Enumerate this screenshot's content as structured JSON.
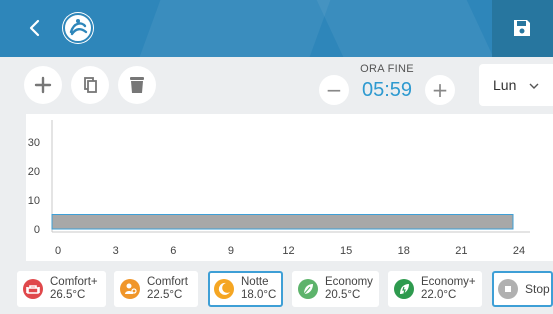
{
  "header": {
    "back_icon": "chevron-left-icon",
    "logo_icon": "climate-logo-icon",
    "save_icon": "floppy-disk-icon",
    "color": "#2e86ba"
  },
  "toolbar": {
    "add_icon": "plus-icon",
    "copy_icon": "copy-icon",
    "delete_icon": "trash-icon",
    "end_time_label": "ORA FINE",
    "decrement_label": "−",
    "increment_label": "+",
    "end_time_value": "05:59",
    "day_value": "Lun"
  },
  "chart_data": {
    "type": "bar",
    "x_ticks": [
      "0",
      "3",
      "6",
      "9",
      "12",
      "15",
      "18",
      "21",
      "24"
    ],
    "y_ticks": [
      "0",
      "10",
      "20",
      "30"
    ],
    "xlim": [
      0,
      24
    ],
    "ylim": [
      0,
      30
    ],
    "segments": [
      {
        "start": 0,
        "end": 24,
        "value": 5,
        "color": "#a8a8a8",
        "border": "#3e9fd6"
      }
    ],
    "grid": false
  },
  "modes": [
    {
      "name": "Comfort+",
      "temp": "26.5°C",
      "color": "#e0484b",
      "icon": "sofa-icon",
      "active": false
    },
    {
      "name": "Comfort",
      "temp": "22.5°C",
      "color": "#f0962a",
      "icon": "person-icon",
      "active": false
    },
    {
      "name": "Notte",
      "temp": "18.0°C",
      "color": "#f5a623",
      "icon": "moon-icon",
      "active": true
    },
    {
      "name": "Economy",
      "temp": "20.5°C",
      "color": "#5db36b",
      "icon": "leaf-icon",
      "active": false
    },
    {
      "name": "Economy+",
      "temp": "22.0°C",
      "color": "#2e9a4e",
      "icon": "eco-leaf-icon",
      "active": false
    },
    {
      "name": "Stop",
      "temp": "",
      "color": "#b0b0b0",
      "icon": "stop-icon",
      "active": true
    }
  ]
}
